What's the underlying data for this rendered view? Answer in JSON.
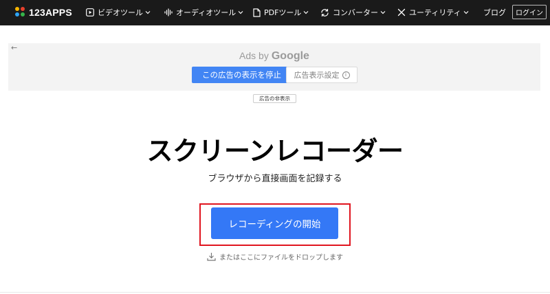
{
  "topbar": {
    "logo_text": "123APPS",
    "nav": [
      {
        "label": "ビデオツール",
        "icon": "video-icon"
      },
      {
        "label": "オーディオツール",
        "icon": "audio-wave-icon"
      },
      {
        "label": "PDFツール",
        "icon": "pdf-file-icon"
      },
      {
        "label": "コンバーター",
        "icon": "convert-icon"
      },
      {
        "label": "ユーティリティ",
        "icon": "tools-icon"
      }
    ],
    "blog_label": "ブログ",
    "login_label": "ログイン"
  },
  "ad": {
    "back_arrow": "←",
    "ads_by": "Ads by",
    "google": "Google",
    "stop_label": "この広告の表示を停止",
    "settings_label": "広告表示設定",
    "settings_info": "i",
    "hide_label": "広告の非表示"
  },
  "hero": {
    "title": "スクリーンレコーダー",
    "subtitle": "ブラウザから直接画面を記録する",
    "start_label": "レコーディングの開始",
    "drop_hint": "またはここにファイルをドロップします"
  },
  "colors": {
    "topbar_bg": "#1a1a1a",
    "primary_button": "#3478f6",
    "ad_button": "#4285f4",
    "focus_outline": "#e0141e",
    "logo_dots": [
      "#f7b500",
      "#e8412c",
      "#2ea3f2",
      "#35b34a"
    ]
  }
}
